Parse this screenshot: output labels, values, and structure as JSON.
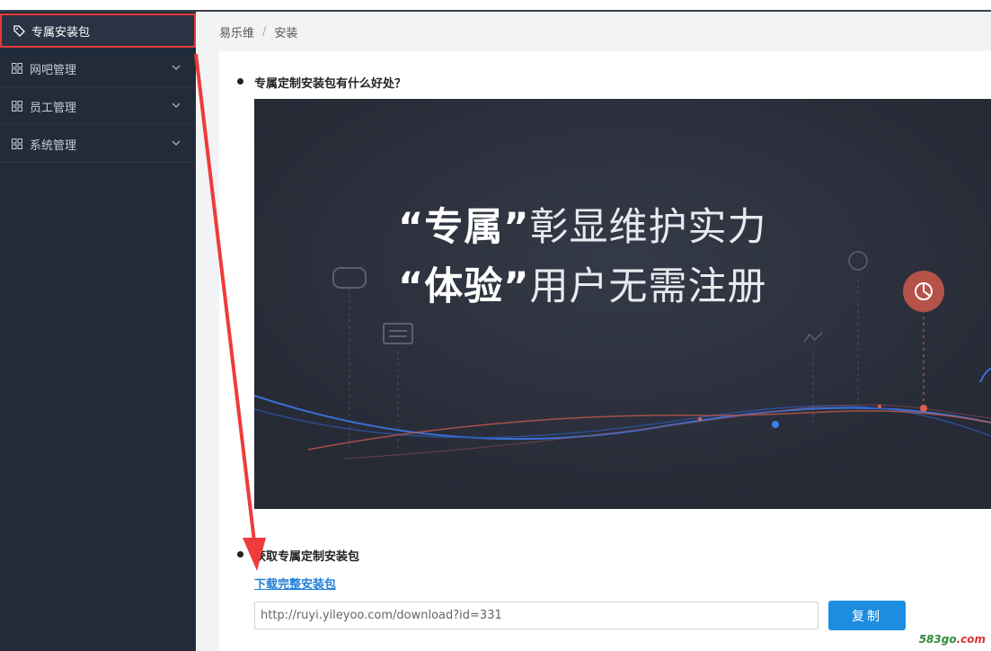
{
  "sidebar": {
    "items": [
      {
        "label": "专属安装包",
        "icon": "tag-icon",
        "active": true
      },
      {
        "label": "网吧管理",
        "icon": "grid-icon"
      },
      {
        "label": "员工管理",
        "icon": "grid-icon"
      },
      {
        "label": "系统管理",
        "icon": "grid-icon"
      }
    ]
  },
  "breadcrumb": {
    "root": "易乐维",
    "current": "安装"
  },
  "main": {
    "section1_title": "专属定制安装包有什么好处？",
    "banner": {
      "line1_quoted": "“专属”",
      "line1_rest": "彰显维护实力",
      "line2_quoted": "“体验”",
      "line2_rest": "用户无需注册"
    },
    "section2_title": "获取专属定制安装包",
    "download_link": "下载完整安装包",
    "url_value": "http://ruyi.yileyoo.com/download?id=331",
    "copy_label": "复制"
  },
  "watermark": {
    "part1": "583go",
    "part2": ".com"
  },
  "colors": {
    "accent": "#1c8de0",
    "sidebar_bg": "#222b3a",
    "highlight": "#e8393a"
  }
}
